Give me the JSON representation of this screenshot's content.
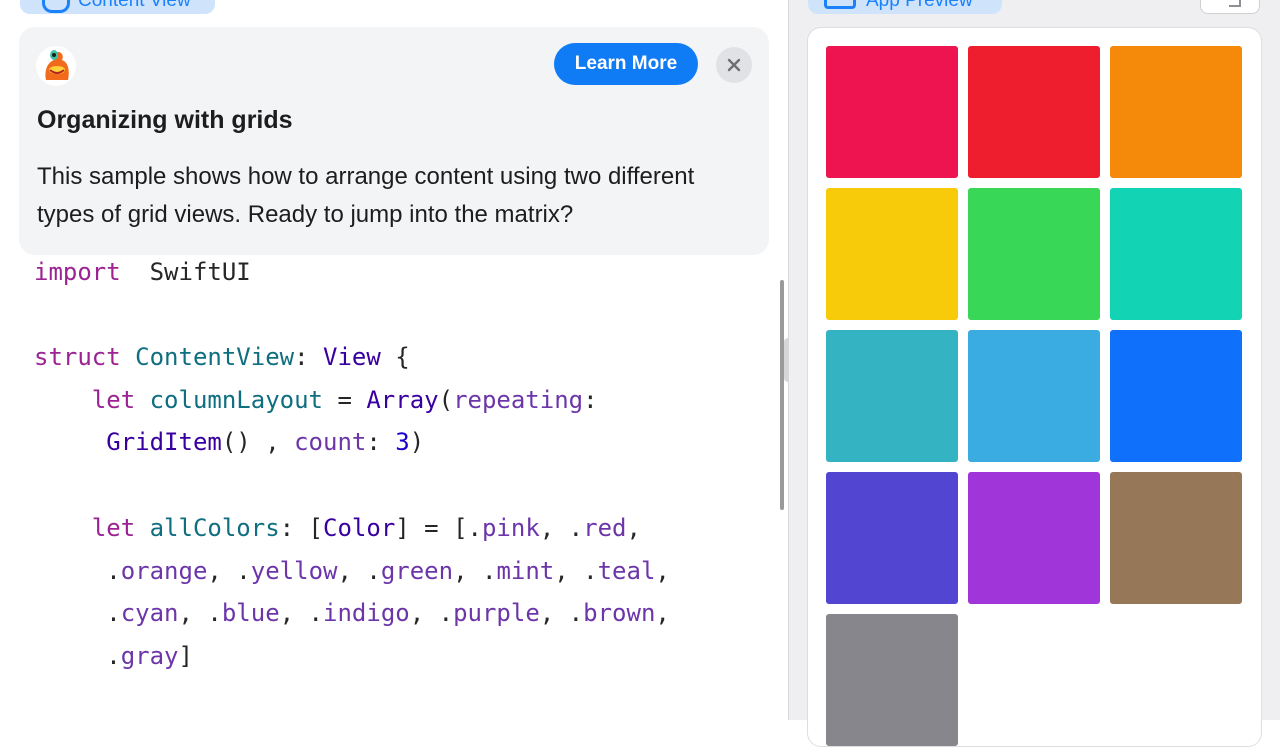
{
  "tabs": {
    "content": {
      "label": "Content View",
      "icon": "bubble-icon"
    },
    "preview": {
      "label": "App Preview",
      "icon": "device-icon"
    }
  },
  "tip": {
    "mascot": "orange-creature-mascot",
    "learn_more": "Learn More",
    "close_icon": "close-icon",
    "title": "Organizing with grids",
    "body": "This sample shows how to arrange content using two different types of grid views. Ready to jump into the matrix?"
  },
  "code_lines": [
    [
      [
        "kw",
        "import"
      ],
      [
        "",
        "  SwiftUI"
      ]
    ],
    [],
    [
      [
        "kw",
        "struct"
      ],
      [
        "",
        " "
      ],
      [
        "id",
        "ContentView"
      ],
      [
        "",
        ": "
      ],
      [
        "ty",
        "View"
      ],
      [
        "",
        " {"
      ]
    ],
    [
      [
        "",
        "    "
      ],
      [
        "kw",
        "let"
      ],
      [
        "",
        " "
      ],
      [
        "id",
        "columnLayout"
      ],
      [
        "",
        " = "
      ],
      [
        "ty",
        "Array"
      ],
      [
        "",
        "("
      ],
      [
        "mb",
        "repeating"
      ],
      [
        "",
        ":"
      ]
    ],
    [
      [
        "",
        "     "
      ],
      [
        "ty",
        "GridItem"
      ],
      [
        "",
        "() , "
      ],
      [
        "mb",
        "count"
      ],
      [
        "",
        ": "
      ],
      [
        "nm",
        "3"
      ],
      [
        "",
        ")"
      ]
    ],
    [],
    [
      [
        "",
        "    "
      ],
      [
        "kw",
        "let"
      ],
      [
        "",
        " "
      ],
      [
        "id",
        "allColors"
      ],
      [
        "",
        ": ["
      ],
      [
        "ty",
        "Color"
      ],
      [
        "",
        "] = [."
      ],
      [
        "mb",
        "pink"
      ],
      [
        "",
        ", ."
      ],
      [
        "mb",
        "red"
      ],
      [
        "",
        ","
      ]
    ],
    [
      [
        "",
        "     ."
      ],
      [
        "mb",
        "orange"
      ],
      [
        "",
        ", ."
      ],
      [
        "mb",
        "yellow"
      ],
      [
        "",
        ", ."
      ],
      [
        "mb",
        "green"
      ],
      [
        "",
        ", ."
      ],
      [
        "mb",
        "mint"
      ],
      [
        "",
        ", ."
      ],
      [
        "mb",
        "teal"
      ],
      [
        "",
        ","
      ]
    ],
    [
      [
        "",
        "     ."
      ],
      [
        "mb",
        "cyan"
      ],
      [
        "",
        ", ."
      ],
      [
        "mb",
        "blue"
      ],
      [
        "",
        ", ."
      ],
      [
        "mb",
        "indigo"
      ],
      [
        "",
        ", ."
      ],
      [
        "mb",
        "purple"
      ],
      [
        "",
        ", ."
      ],
      [
        "mb",
        "brown"
      ],
      [
        "",
        ","
      ]
    ],
    [
      [
        "",
        "     ."
      ],
      [
        "mb",
        "gray"
      ],
      [
        "",
        "]"
      ]
    ]
  ],
  "colors": {
    "accent": "#0f7bf5",
    "keyword": "#9b2393",
    "type": "#3900a0",
    "identifier": "#0f6e80",
    "member": "#6c36a9",
    "number": "#1c00cf"
  },
  "preview": {
    "expand_icon": "expand-icon",
    "tiles": [
      {
        "name": "pink",
        "color": "#ee1450"
      },
      {
        "name": "red",
        "color": "#ef1e2e"
      },
      {
        "name": "orange",
        "color": "#f5890a"
      },
      {
        "name": "yellow",
        "color": "#f8cb0a"
      },
      {
        "name": "green",
        "color": "#38d758"
      },
      {
        "name": "mint",
        "color": "#13d3b5"
      },
      {
        "name": "teal",
        "color": "#34b3c3"
      },
      {
        "name": "cyan",
        "color": "#3aace2"
      },
      {
        "name": "blue",
        "color": "#0f70fb"
      },
      {
        "name": "indigo",
        "color": "#5145d1"
      },
      {
        "name": "purple",
        "color": "#a035da"
      },
      {
        "name": "brown",
        "color": "#967858"
      },
      {
        "name": "gray",
        "color": "#86868c"
      }
    ]
  }
}
